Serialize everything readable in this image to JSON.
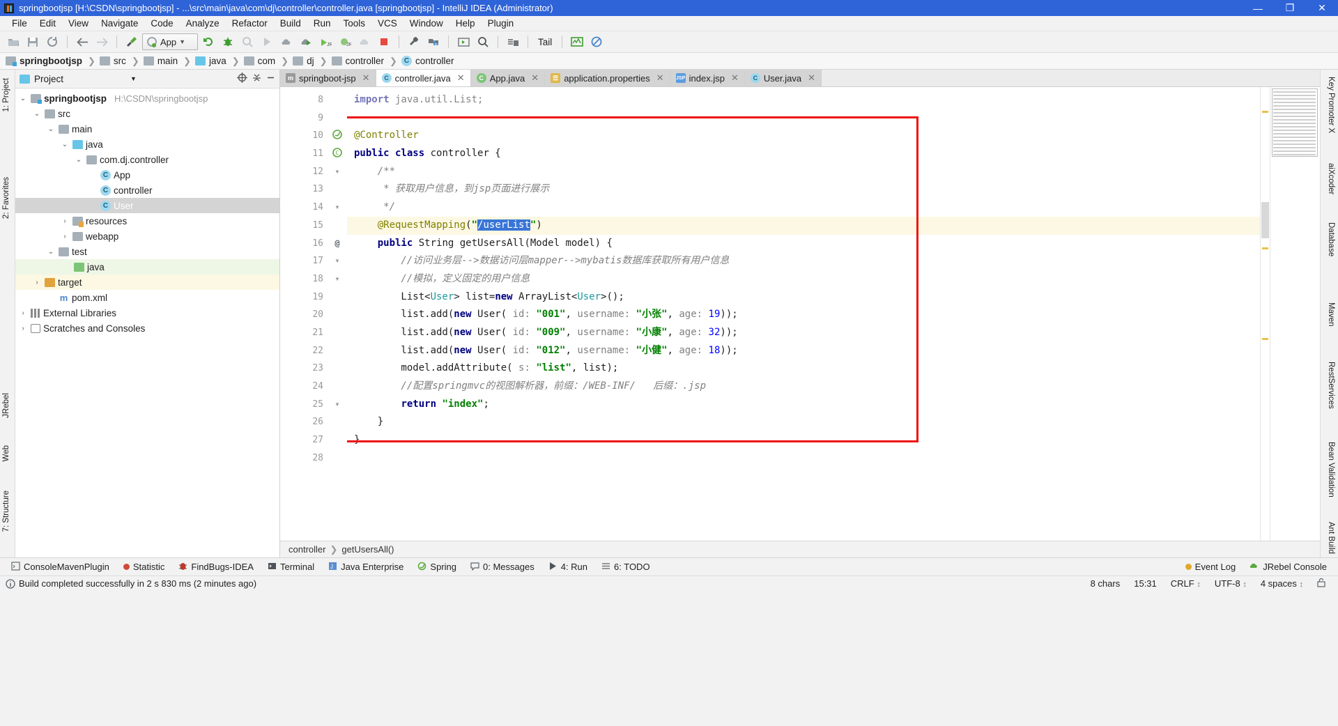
{
  "window": {
    "title": "springbootjsp [H:\\CSDN\\springbootjsp] - ...\\src\\main\\java\\com\\dj\\controller\\controller.java [springbootjsp] - IntelliJ IDEA (Administrator)",
    "minimize": "—",
    "maximize": "❐",
    "close": "✕",
    "accent_color": "#2f63d8"
  },
  "menubar": [
    {
      "label": "File"
    },
    {
      "label": "Edit"
    },
    {
      "label": "View"
    },
    {
      "label": "Navigate"
    },
    {
      "label": "Code"
    },
    {
      "label": "Analyze"
    },
    {
      "label": "Refactor"
    },
    {
      "label": "Build"
    },
    {
      "label": "Run"
    },
    {
      "label": "Tools"
    },
    {
      "label": "VCS"
    },
    {
      "label": "Window"
    },
    {
      "label": "Help"
    },
    {
      "label": "Plugin"
    }
  ],
  "toolbar": {
    "run_config": "App",
    "tail_label": "Tail",
    "icons": [
      "open-folder-icon",
      "save-icon",
      "sync-icon",
      "back-arrow-icon",
      "forward-arrow-icon",
      "build-hammer-icon",
      "run-icon",
      "debug-icon",
      "coverage-icon",
      "profile-icon",
      "stop-gray-icon",
      "rerun-icon",
      "jrebel-run-icon",
      "jrebel-debug-icon",
      "jrebel-gray-icon",
      "stop-red-icon",
      "settings-wrench-icon",
      "project-structure-icon",
      "terminal-icon",
      "search-everywhere-icon",
      "deploy-icon",
      "chart-icon",
      "no-entry-icon"
    ]
  },
  "breadcrumbs": [
    {
      "label": "springbootjsp",
      "icon": "module-icon",
      "bold": true
    },
    {
      "label": "src",
      "icon": "folder-icon"
    },
    {
      "label": "main",
      "icon": "folder-icon"
    },
    {
      "label": "java",
      "icon": "source-folder-icon"
    },
    {
      "label": "com",
      "icon": "package-icon"
    },
    {
      "label": "dj",
      "icon": "package-icon"
    },
    {
      "label": "controller",
      "icon": "package-icon"
    },
    {
      "label": "controller",
      "icon": "class-icon"
    }
  ],
  "left_rail": [
    {
      "label": "1: Project"
    },
    {
      "label": "2: Favorites"
    },
    {
      "label": "JRebel"
    },
    {
      "label": "Web"
    },
    {
      "label": "7: Structure"
    }
  ],
  "right_rail": [
    {
      "label": "Key Promoter X"
    },
    {
      "label": "aiXcoder"
    },
    {
      "label": "Database"
    },
    {
      "label": "Maven"
    },
    {
      "label": "RestServices"
    },
    {
      "label": "Bean Validation"
    },
    {
      "label": "Ant Build"
    }
  ],
  "project_panel": {
    "title": "Project",
    "dropdown_icon": "chevron-down-icon",
    "locate_icon": "target-icon",
    "collapse_icon": "collapse-all-icon",
    "hide_icon": "hide-icon",
    "tree": [
      {
        "label": "springbootjsp",
        "detail": "H:\\CSDN\\springbootjsp",
        "indent": 0,
        "arrow": "⌄",
        "icon": "module",
        "bold": true,
        "state": ""
      },
      {
        "label": "src",
        "indent": 1,
        "arrow": "⌄",
        "icon": "folder",
        "state": ""
      },
      {
        "label": "main",
        "indent": 2,
        "arrow": "⌄",
        "icon": "folder",
        "state": ""
      },
      {
        "label": "java",
        "indent": 3,
        "arrow": "⌄",
        "icon": "source",
        "state": ""
      },
      {
        "label": "com.dj.controller",
        "indent": 4,
        "arrow": "⌄",
        "icon": "package",
        "state": ""
      },
      {
        "label": "App",
        "indent": 5,
        "arrow": "",
        "icon": "runclass",
        "state": ""
      },
      {
        "label": "controller",
        "indent": 5,
        "arrow": "",
        "icon": "class",
        "state": ""
      },
      {
        "label": "User",
        "indent": 5,
        "arrow": "",
        "icon": "class",
        "state": "sel"
      },
      {
        "label": "resources",
        "indent": 3,
        "arrow": "›",
        "icon": "resources",
        "state": ""
      },
      {
        "label": "webapp",
        "indent": 3,
        "arrow": "›",
        "icon": "folder",
        "state": ""
      },
      {
        "label": "test",
        "indent": 2,
        "arrow": "⌄",
        "icon": "folder",
        "state": ""
      },
      {
        "label": "java",
        "indent": 3,
        "arrow": "",
        "icon": "greenfolder",
        "state": "green"
      },
      {
        "label": "target",
        "indent": 1,
        "arrow": "›",
        "icon": "targetfolder",
        "state": "yellow"
      },
      {
        "label": "pom.xml",
        "indent": 2,
        "arrow": "",
        "icon": "maven",
        "state": ""
      },
      {
        "label": "External Libraries",
        "indent": 0,
        "arrow": "›",
        "icon": "library",
        "state": ""
      },
      {
        "label": "Scratches and Consoles",
        "indent": 0,
        "arrow": "›",
        "icon": "scratch",
        "state": ""
      }
    ]
  },
  "editor_tabs": [
    {
      "label": "springboot-jsp",
      "icon": "maven-icon",
      "active": false,
      "close": "✕"
    },
    {
      "label": "controller.java",
      "icon": "class-icon",
      "active": true,
      "close": "✕"
    },
    {
      "label": "App.java",
      "icon": "spring-class-icon",
      "active": false,
      "close": "✕"
    },
    {
      "label": "application.properties",
      "icon": "properties-icon",
      "active": false,
      "close": "✕"
    },
    {
      "label": "index.jsp",
      "icon": "jsp-icon",
      "active": false,
      "close": "✕"
    },
    {
      "label": "User.java",
      "icon": "class-icon",
      "active": false,
      "close": "✕"
    }
  ],
  "code": {
    "first_visible_line": 8,
    "lines": [
      {
        "num": 8,
        "text": "import java.util.List;",
        "kind": "dimmed"
      },
      {
        "num": 9,
        "text": ""
      },
      {
        "num": 10,
        "text": "@Controller",
        "kind": "annotation",
        "gutter_icon": "spring-bean-icon"
      },
      {
        "num": 11,
        "text": "public class controller {",
        "kind": "classdecl",
        "gutter_icon": "spring-controller-icon"
      },
      {
        "num": 12,
        "text": "    /**",
        "kind": "comment",
        "fold": true
      },
      {
        "num": 13,
        "text": "     * 获取用户信息，到jsp页面进行展示",
        "kind": "comment"
      },
      {
        "num": 14,
        "text": "     */",
        "kind": "comment"
      },
      {
        "num": 15,
        "text": "    @RequestMapping(\"/userList\")",
        "kind": "requestmapping",
        "highlighted": true,
        "selection": "/userList"
      },
      {
        "num": 16,
        "text": "    public String getUsersAll(Model model) {",
        "kind": "method",
        "gutter_icon": "at-icon",
        "fold": true
      },
      {
        "num": 17,
        "text": "        //访问业务层-->数据访问层mapper-->mybatis数据库获取所有用户信息",
        "kind": "comment"
      },
      {
        "num": 18,
        "text": "        //模拟，定义固定的用户信息",
        "kind": "comment",
        "fold": true
      },
      {
        "num": 19,
        "text": "        List<User> list=new ArrayList<User>();",
        "kind": "listdecl"
      },
      {
        "num": 20,
        "text": "        list.add(new User( id: \"001\", username: \"小张\", age: 19));",
        "kind": "listadd"
      },
      {
        "num": 21,
        "text": "        list.add(new User( id: \"009\", username: \"小康\", age: 32));",
        "kind": "listadd"
      },
      {
        "num": 22,
        "text": "        list.add(new User( id: \"012\", username: \"小健\", age: 18));",
        "kind": "listadd"
      },
      {
        "num": 23,
        "text": "        model.addAttribute( s: \"list\", list);",
        "kind": "addattr"
      },
      {
        "num": 24,
        "text": "        //配置springmvc的视图解析器，前缀：/WEB-INF/   后缀：.jsp",
        "kind": "comment"
      },
      {
        "num": 25,
        "text": "        return \"index\";",
        "kind": "return"
      },
      {
        "num": 26,
        "text": "    }",
        "kind": "plain"
      },
      {
        "num": 27,
        "text": "}",
        "kind": "plain"
      },
      {
        "num": 28,
        "text": ""
      }
    ],
    "highlight_box_color": "#ee1111"
  },
  "editor_breadcrumb": [
    {
      "label": "controller"
    },
    {
      "label": "getUsersAll()"
    }
  ],
  "bottom_tools": [
    {
      "label": "ConsoleMavenPlugin",
      "icon": "maven-console-icon"
    },
    {
      "label": "Statistic",
      "icon": "statistic-icon"
    },
    {
      "label": "FindBugs-IDEA",
      "icon": "findbugs-icon"
    },
    {
      "label": "Terminal",
      "icon": "terminal-icon"
    },
    {
      "label": "Java Enterprise",
      "icon": "java-enterprise-icon"
    },
    {
      "label": "Spring",
      "icon": "spring-icon"
    },
    {
      "label": "0: Messages",
      "icon": "messages-icon",
      "mnemonic": "0"
    },
    {
      "label": "4: Run",
      "icon": "run-icon",
      "mnemonic": "4"
    },
    {
      "label": "6: TODO",
      "icon": "todo-icon",
      "mnemonic": "6"
    }
  ],
  "bottom_tools_right": [
    {
      "label": "Event Log",
      "icon": "event-log-icon"
    },
    {
      "label": "JRebel Console",
      "icon": "jrebel-icon"
    }
  ],
  "statusbar": {
    "message": "Build completed successfully in 2 s 830 ms (2 minutes ago)",
    "message_icon": "info-icon",
    "chars": "8 chars",
    "caret": "15:31",
    "line_separator": "CRLF",
    "encoding": "UTF-8",
    "indent": "4 spaces",
    "chevron": "↕",
    "lock_icon": "unlocked-icon"
  }
}
